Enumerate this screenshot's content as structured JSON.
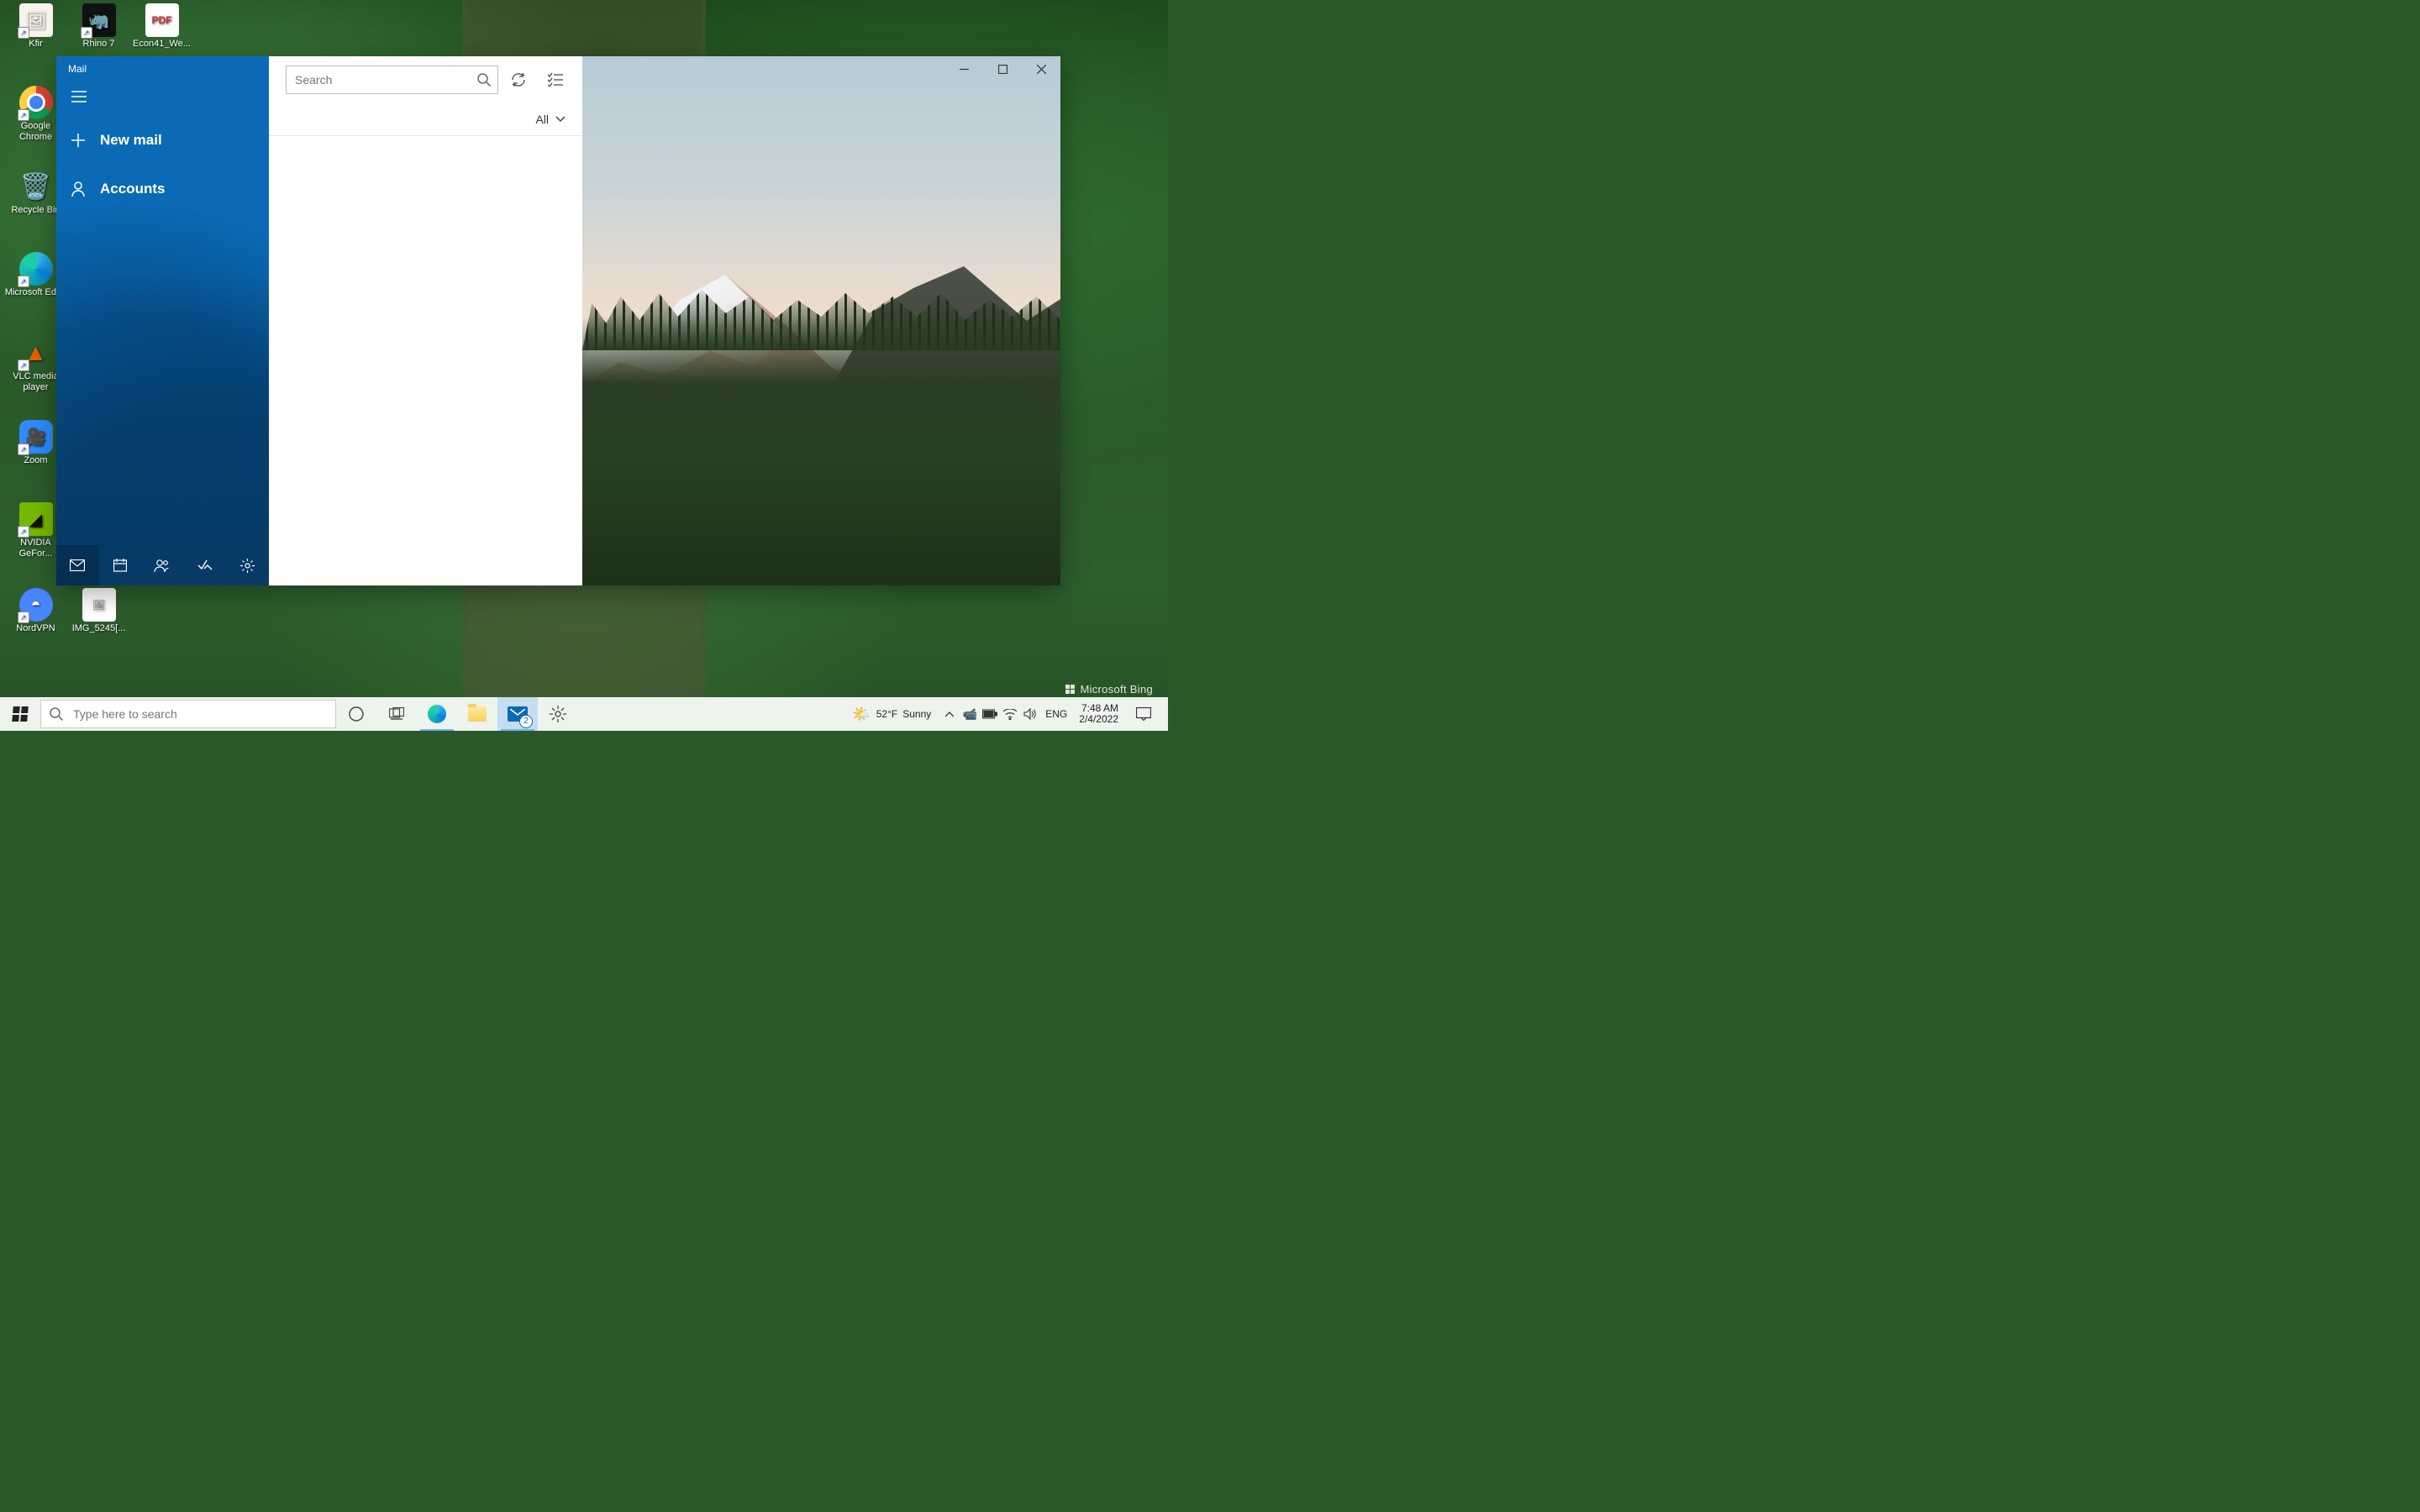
{
  "desktop": {
    "bing_credit": "Microsoft Bing",
    "icons": [
      {
        "label": "Kfir",
        "color": "#f7f3ea",
        "glyph": "🖼"
      },
      {
        "label": "Rhino 7",
        "color": "#111",
        "glyph": "🦏"
      },
      {
        "label": "Econ41_We...",
        "color": "#fff",
        "glyph": "PDF"
      },
      {
        "label": "Google Chrome",
        "color": "#fff",
        "glyph": "◎"
      },
      {
        "label": "Recycle Bin",
        "color": "transparent",
        "glyph": "🗑"
      },
      {
        "label": "Microsoft Edge",
        "color": "transparent",
        "glyph": "🌐"
      },
      {
        "label": "VLC media player",
        "color": "transparent",
        "glyph": "▲"
      },
      {
        "label": "Zoom",
        "color": "#2d8cff",
        "glyph": "🎥"
      },
      {
        "label": "NVIDIA GeFor...",
        "color": "#76b900",
        "glyph": "◢"
      },
      {
        "label": "NordVPN",
        "color": "#4687ff",
        "glyph": "⬤"
      },
      {
        "label": "IMG_5245[...",
        "color": "#fff",
        "glyph": "🖼"
      }
    ]
  },
  "mail": {
    "title": "Mail",
    "new_mail": "New mail",
    "accounts": "Accounts",
    "search_placeholder": "Search",
    "filter_label": "All",
    "footer_icons": [
      "mail",
      "calendar",
      "people",
      "todo",
      "settings"
    ]
  },
  "taskbar": {
    "search_placeholder": "Type here to search",
    "weather_temp": "52°F",
    "weather_desc": "Sunny",
    "language": "ENG",
    "time": "7:48 AM",
    "date": "2/4/2022",
    "mail_badge": "2"
  }
}
